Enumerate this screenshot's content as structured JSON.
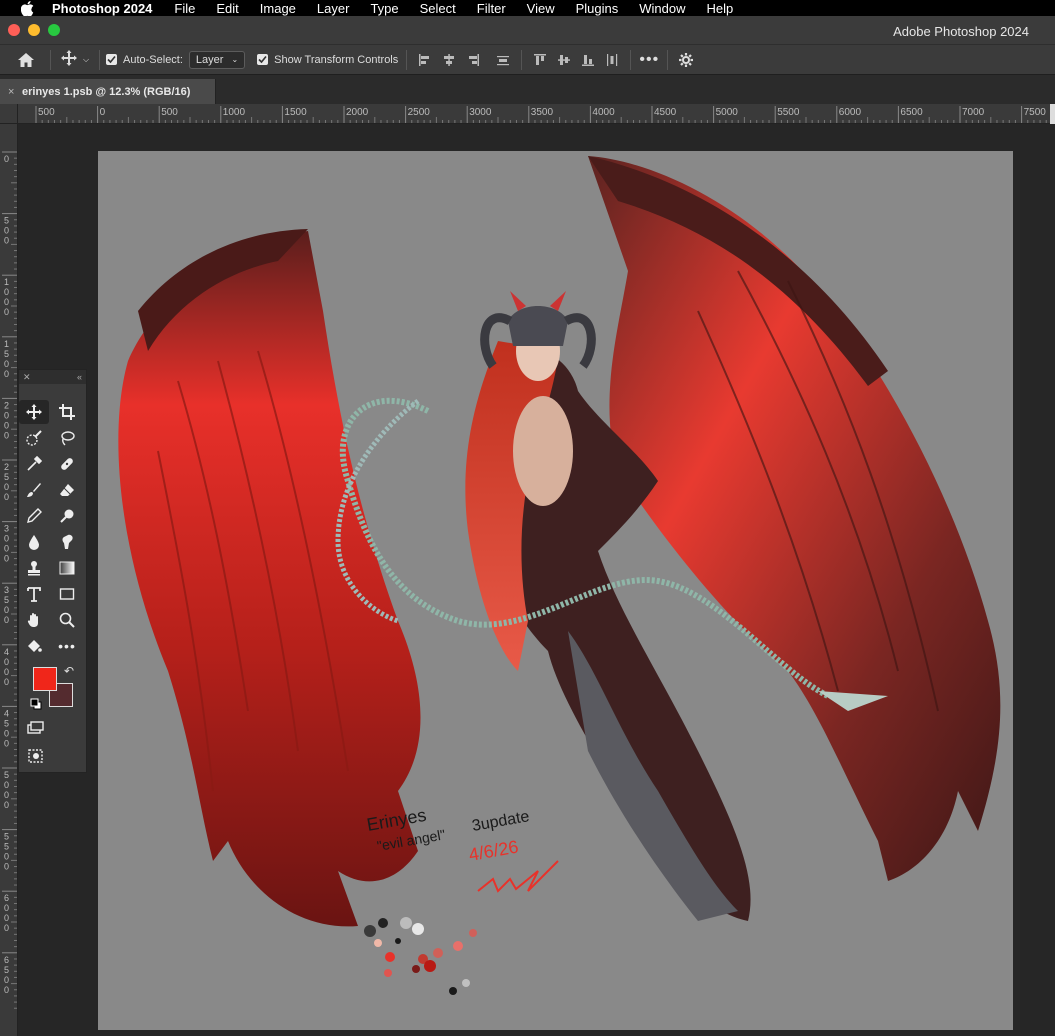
{
  "menubar": {
    "app_name": "Photoshop 2024",
    "items": [
      "File",
      "Edit",
      "Image",
      "Layer",
      "Type",
      "Select",
      "Filter",
      "View",
      "Plugins",
      "Window",
      "Help"
    ]
  },
  "titlebar": {
    "title": "Adobe Photoshop 2024"
  },
  "options": {
    "auto_select_label": "Auto-Select:",
    "auto_select_value": "Layer",
    "transform_label": "Show Transform Controls"
  },
  "document_tab": {
    "label": "erinyes 1.psb @ 12.3% (RGB/16)",
    "close": "×"
  },
  "ruler_top_labels": [
    "500",
    "0",
    "500",
    "1000",
    "1500",
    "2000",
    "2500",
    "3000",
    "3500",
    "4000",
    "4500",
    "5000",
    "5500",
    "6000",
    "6500",
    "7000",
    "7500"
  ],
  "ruler_left_labels": [
    "0",
    "500",
    "1000",
    "1500",
    "2000",
    "2500",
    "3000",
    "3500",
    "4000",
    "4500",
    "5000",
    "5500",
    "6000",
    "6500"
  ],
  "artwork": {
    "signature_line1": "Erinyes",
    "signature_line2": "\"evil angel\"",
    "signature_line3": "3update",
    "signature_date": "4/6/26"
  },
  "colors": {
    "foreground": "#f0261a",
    "background": "#542b2f",
    "canvas": "#898989"
  },
  "toolbox_tools": [
    "move-tool",
    "crop-tool",
    "quick-selection-tool",
    "lasso-tool",
    "eyedropper-tool",
    "healing-brush-tool",
    "brush-tool",
    "eraser-tool",
    "pencil-tool",
    "dodge-tool",
    "blur-tool",
    "smudge-tool",
    "clone-stamp-tool",
    "gradient-tool",
    "type-tool",
    "rectangle-tool",
    "hand-tool",
    "zoom-tool",
    "paint-bucket-tool",
    "more-tools",
    "screen-mode-tool",
    "quick-mask-tool"
  ]
}
